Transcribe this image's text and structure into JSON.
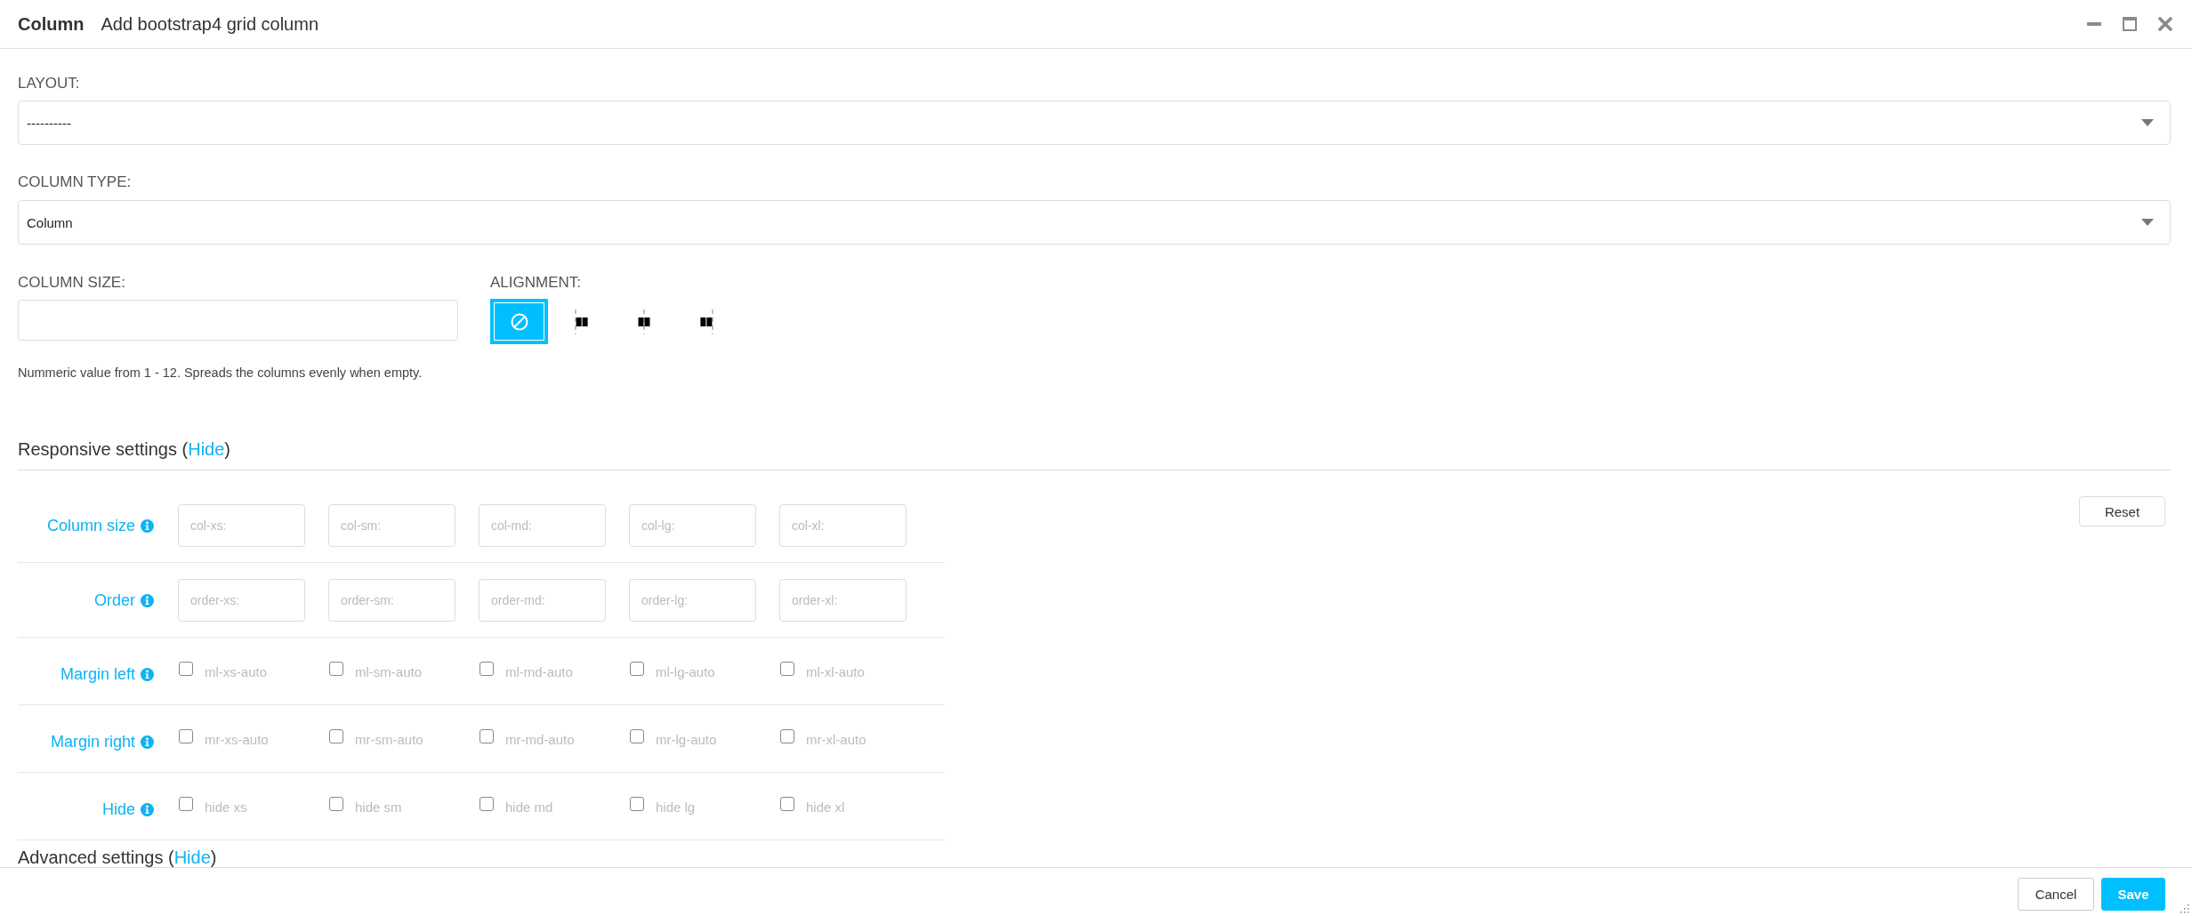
{
  "window": {
    "title": "Column",
    "subtitle": "Add bootstrap4 grid column"
  },
  "selects": [
    {
      "label": "LAYOUT:",
      "value": "----------"
    },
    {
      "label": "COLUMN TYPE:",
      "value": "Column"
    }
  ],
  "column_size": {
    "label": "COLUMN SIZE:",
    "help": "Nummeric value from 1 - 12. Spreads the columns evenly when empty."
  },
  "alignment": {
    "label": "ALIGNMENT:",
    "options": [
      {
        "kind": "none",
        "selected": true
      },
      {
        "kind": "start",
        "selected": false
      },
      {
        "kind": "center",
        "selected": false
      },
      {
        "kind": "end",
        "selected": false
      }
    ]
  },
  "responsive": {
    "heading": "Responsive settings (",
    "link": "Hide",
    "heading_end": ")",
    "reset": "Reset",
    "rows": [
      {
        "label": "Column size",
        "kind": "input",
        "cells": [
          {
            "placeholder": "col-xs:"
          },
          {
            "placeholder": "col-sm:"
          },
          {
            "placeholder": "col-md:"
          },
          {
            "placeholder": "col-lg:"
          },
          {
            "placeholder": "col-xl:"
          }
        ]
      },
      {
        "label": "Order",
        "kind": "input",
        "cells": [
          {
            "placeholder": "order-xs:"
          },
          {
            "placeholder": "order-sm:"
          },
          {
            "placeholder": "order-md:"
          },
          {
            "placeholder": "order-lg:"
          },
          {
            "placeholder": "order-xl:"
          }
        ]
      },
      {
        "label": "Margin left",
        "kind": "checkbox",
        "cells": [
          {
            "label": "ml-xs-auto",
            "checked": false
          },
          {
            "label": "ml-sm-auto",
            "checked": false
          },
          {
            "label": "ml-md-auto",
            "checked": false
          },
          {
            "label": "ml-lg-auto",
            "checked": false
          },
          {
            "label": "ml-xl-auto",
            "checked": false
          }
        ]
      },
      {
        "label": "Margin right",
        "kind": "checkbox",
        "cells": [
          {
            "label": "mr-xs-auto",
            "checked": false
          },
          {
            "label": "mr-sm-auto",
            "checked": false
          },
          {
            "label": "mr-md-auto",
            "checked": false
          },
          {
            "label": "mr-lg-auto",
            "checked": false
          },
          {
            "label": "mr-xl-auto",
            "checked": false
          }
        ]
      },
      {
        "label": "Hide",
        "kind": "checkbox",
        "cells": [
          {
            "label": "hide xs",
            "checked": false
          },
          {
            "label": "hide sm",
            "checked": false
          },
          {
            "label": "hide md",
            "checked": false
          },
          {
            "label": "hide lg",
            "checked": false
          },
          {
            "label": "hide xl",
            "checked": false
          }
        ]
      }
    ]
  },
  "advanced": {
    "heading": "Advanced settings (",
    "link": "Hide",
    "heading_end": ")"
  },
  "footer": {
    "buttons": [
      {
        "label": "Cancel",
        "kind": "secondary"
      },
      {
        "label": "Save",
        "kind": "primary"
      }
    ]
  }
}
